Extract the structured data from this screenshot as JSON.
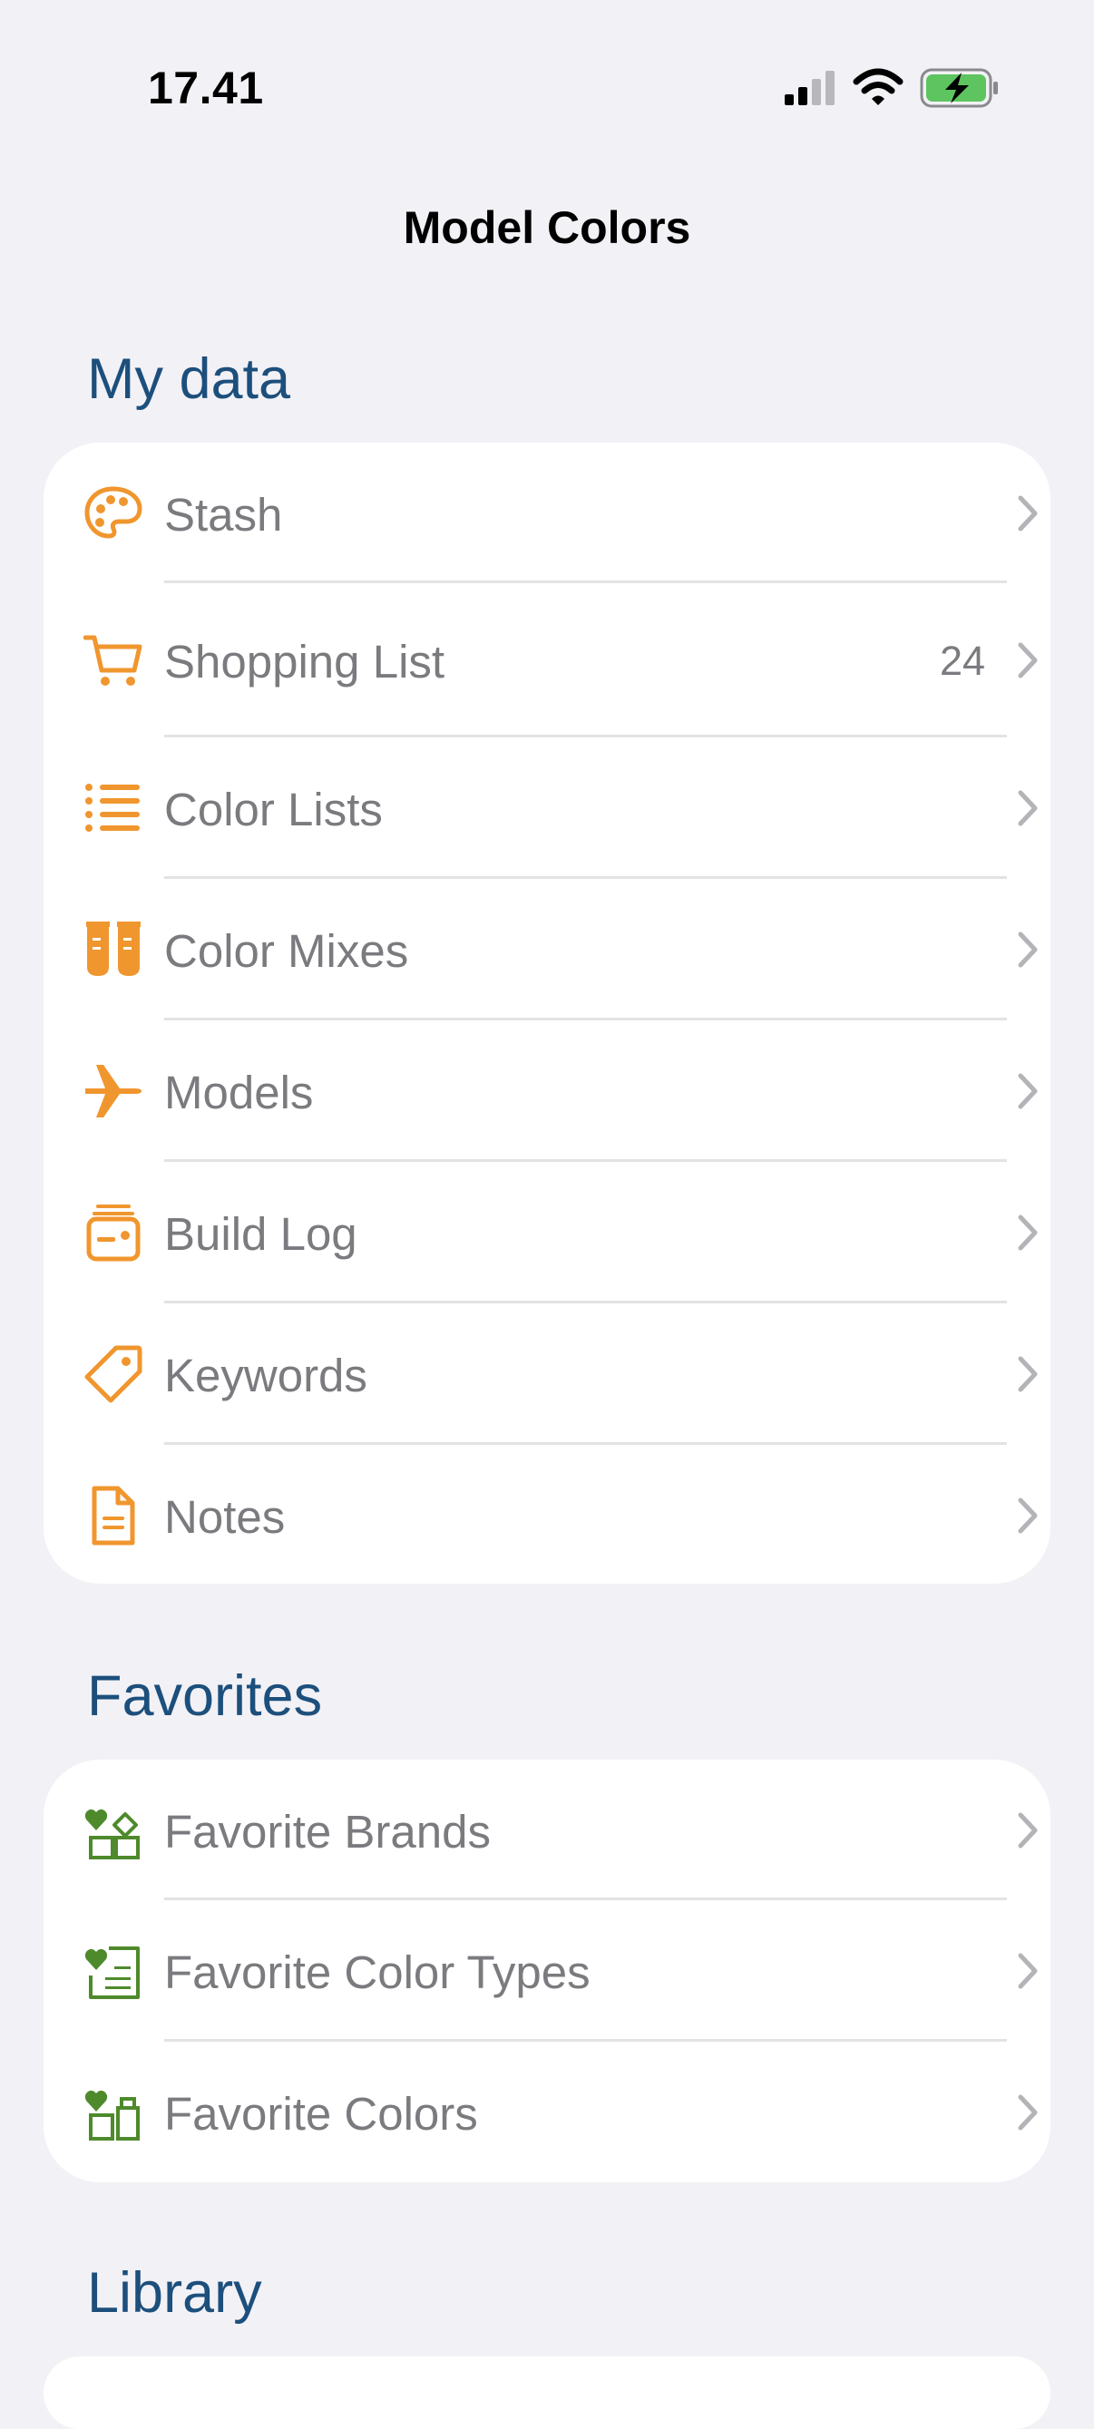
{
  "status_bar": {
    "time": "17.41"
  },
  "nav": {
    "title": "Model Colors"
  },
  "sections": {
    "my_data": {
      "header": "My data",
      "items": [
        {
          "label": "Stash",
          "icon": "palette-icon"
        },
        {
          "label": "Shopping List",
          "icon": "cart-icon",
          "badge": "24"
        },
        {
          "label": "Color Lists",
          "icon": "list-icon"
        },
        {
          "label": "Color Mixes",
          "icon": "test-tubes-icon"
        },
        {
          "label": "Models",
          "icon": "airplane-icon"
        },
        {
          "label": "Build Log",
          "icon": "build-log-icon"
        },
        {
          "label": "Keywords",
          "icon": "tag-icon"
        },
        {
          "label": "Notes",
          "icon": "document-icon"
        }
      ]
    },
    "favorites": {
      "header": "Favorites",
      "items": [
        {
          "label": "Favorite Brands",
          "icon": "favorite-brands-icon"
        },
        {
          "label": "Favorite Color Types",
          "icon": "favorite-color-types-icon"
        },
        {
          "label": "Favorite Colors",
          "icon": "favorite-colors-icon"
        }
      ]
    },
    "library": {
      "header": "Library"
    }
  },
  "colors": {
    "background": "#f2f1f6",
    "section_header": "#1c4f7c",
    "icon_orange": "#f0962e",
    "icon_green": "#4e8a2c",
    "label_gray": "#7b7b7f",
    "battery_green": "#5dc460"
  }
}
